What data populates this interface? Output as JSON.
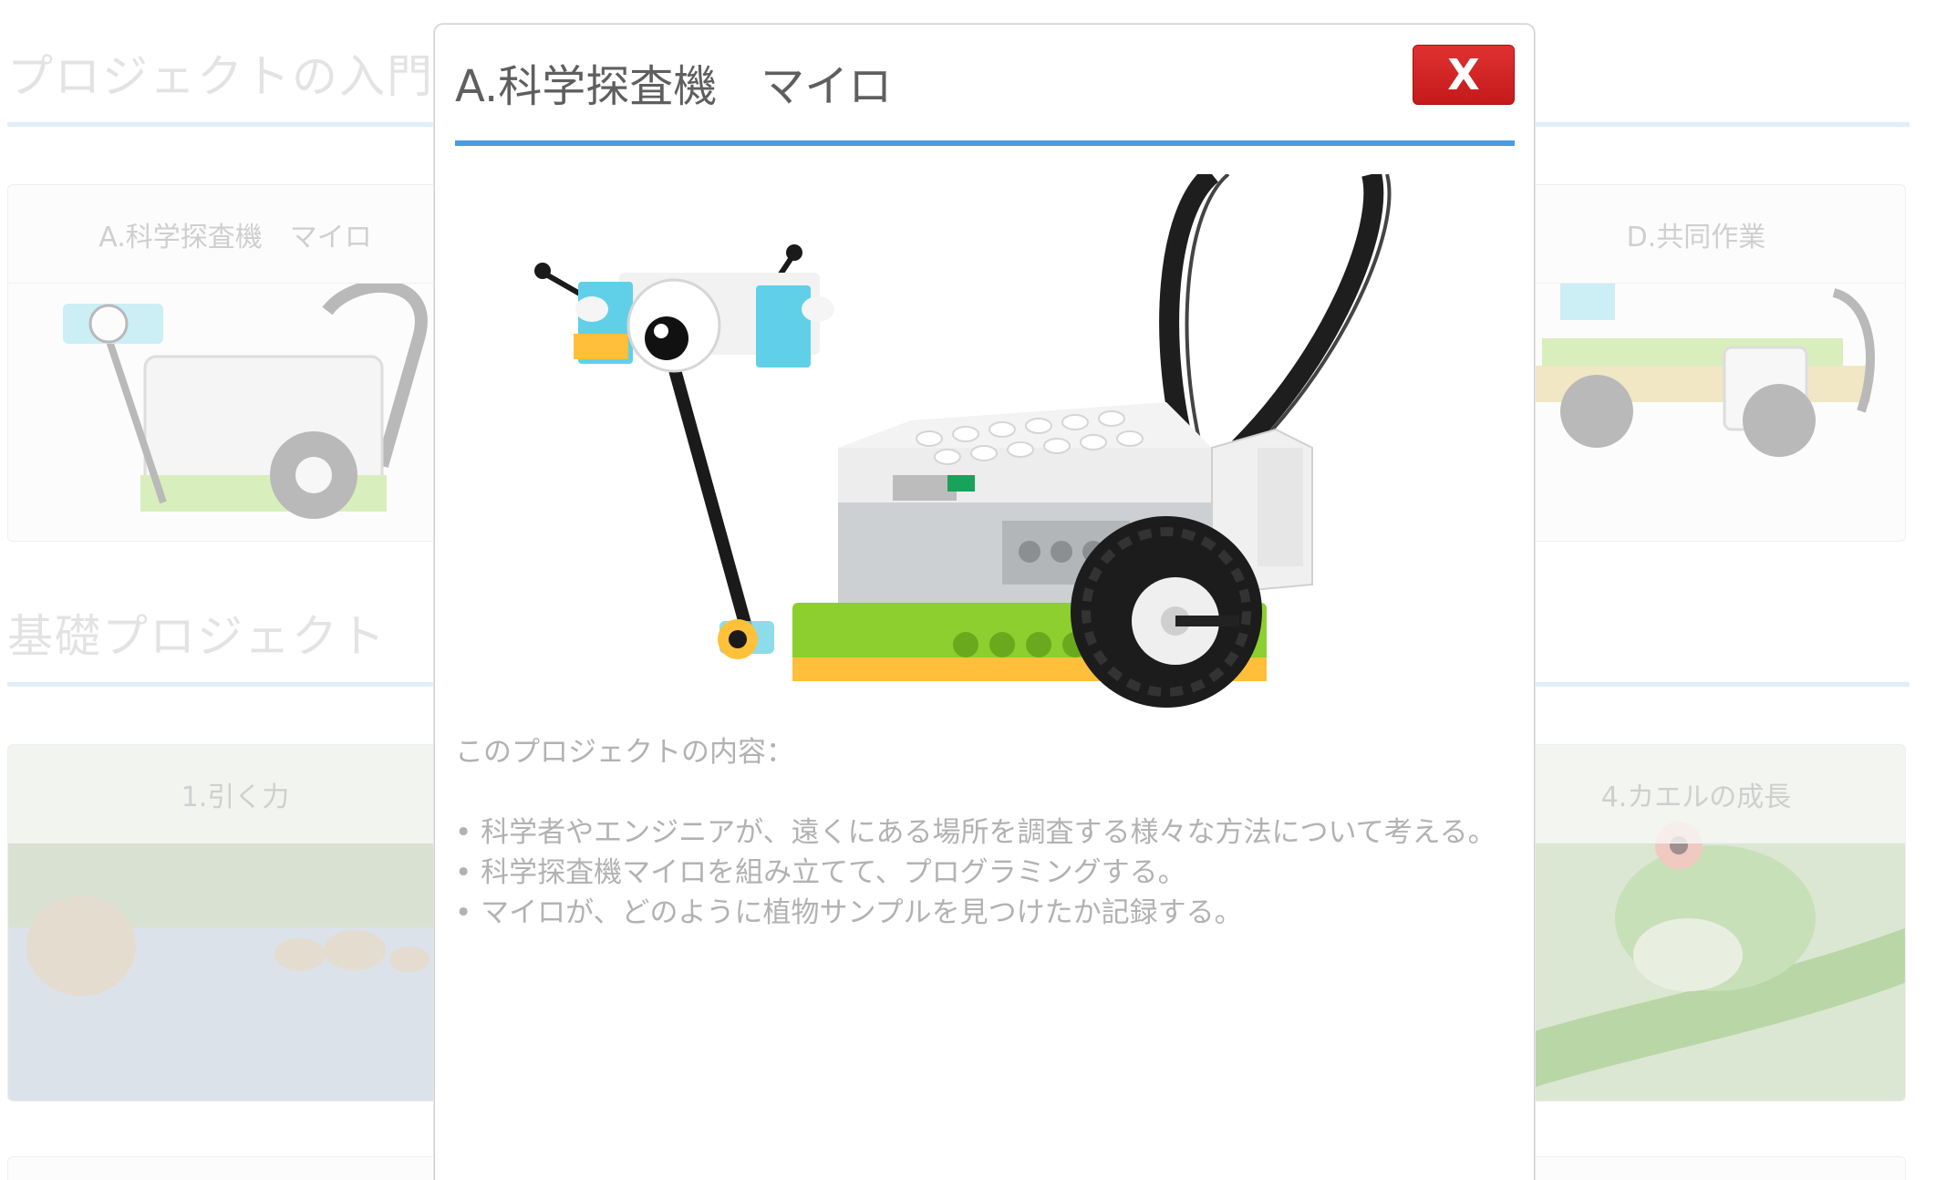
{
  "background": {
    "sections": [
      {
        "title": "プロジェクトの入門"
      },
      {
        "title": "基礎プロジェクト"
      }
    ],
    "intro_cards": [
      {
        "title": "A.科学探査機　マイロ"
      },
      {
        "title": "D.共同作業"
      }
    ],
    "basic_cards": [
      {
        "title": "1.引く力"
      },
      {
        "title": "4.カエルの成長"
      }
    ]
  },
  "modal": {
    "title": "A.科学探査機　マイロ",
    "close_label": "X",
    "content_heading": "このプロジェクトの内容：",
    "bullets": [
      "• 科学者やエンジニアが、遠くにある場所を調査する様々な方法について考える。",
      "• 科学探査機マイロを組み立てて、プログラミングする。",
      "• マイロが、どのように植物サンプルを見つけたか記録する。"
    ]
  },
  "colors": {
    "accent_rule": "#4a9be0",
    "close_button": "#d42424",
    "lego_green": "#8ccf2e",
    "lego_cyan": "#5fd0e8",
    "lego_white": "#f2f2f2",
    "lego_gray": "#c4c6c8"
  }
}
